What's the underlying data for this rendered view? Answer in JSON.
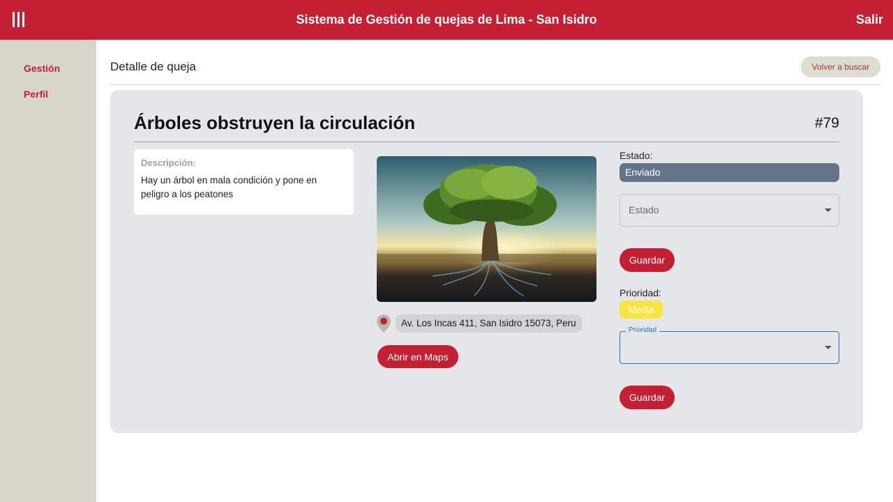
{
  "header": {
    "title": "Sistema de Gestión de quejas de Lima - San Isidro",
    "logout_label": "Salir",
    "menu_icon": "hamburger-menu-icon"
  },
  "sidebar": {
    "items": [
      {
        "label": "Gestión"
      },
      {
        "label": "Perfil"
      }
    ]
  },
  "page": {
    "title": "Detalle de queja",
    "back_label": "Volver a buscar"
  },
  "complaint": {
    "title": "Árboles obstruyen la circulación",
    "id": "#79",
    "description_label": "Descripción:",
    "description": "Hay un árbol en mala condición y pone en peligro a los peatones",
    "address": "Av. Los Incas 411, San Isidro 15073, Peru",
    "maps_label": "Abrir en Maps"
  },
  "status": {
    "label": "Estado:",
    "value": "Enviado",
    "select_placeholder": "Estado",
    "save_label": "Guardar"
  },
  "priority": {
    "label": "Prioridad:",
    "value": "Media",
    "select_label": "Prioridad",
    "save_label": "Guardar"
  },
  "colors": {
    "brand": "#c41f33",
    "sidebar": "#d6d6cb",
    "card": "#e5e6ea",
    "status_pill": "#647589",
    "priority_pill": "#f8e43a"
  }
}
